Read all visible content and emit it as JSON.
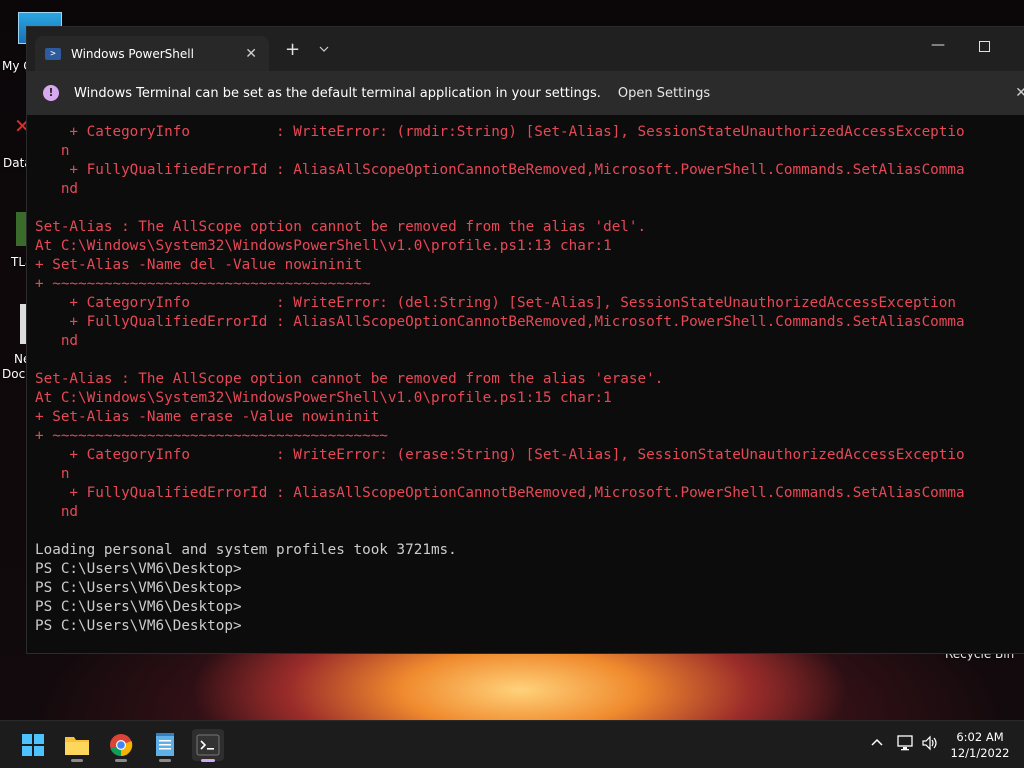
{
  "desktop": {
    "icons": [
      {
        "label": "My C",
        "top": 0
      },
      {
        "label": "Data",
        "top": 0
      },
      {
        "label": "TLa",
        "top": 0
      },
      {
        "label": "Ne",
        "top": 0
      },
      {
        "label": "Docu",
        "top": 0
      }
    ],
    "recycle_bin_label": "Recycle Bin"
  },
  "terminal": {
    "tab_title": "Windows PowerShell",
    "tab_close": "✕",
    "new_tab": "+",
    "dropdown": "⌄",
    "infobar": {
      "message": "Windows Terminal can be set as the default terminal application in your settings.",
      "link": "Open Settings"
    },
    "lines": [
      {
        "text": "    + CategoryInfo          : WriteError: (rmdir:String) [Set-Alias], SessionStateUnauthorizedAccessExceptio",
        "color": "red"
      },
      {
        "text": "   n",
        "color": "red"
      },
      {
        "text": "    + FullyQualifiedErrorId : AliasAllScopeOptionCannotBeRemoved,Microsoft.PowerShell.Commands.SetAliasComma",
        "color": "red"
      },
      {
        "text": "   nd",
        "color": "red"
      },
      {
        "text": "",
        "color": "default"
      },
      {
        "text": "Set-Alias : The AllScope option cannot be removed from the alias 'del'.",
        "color": "red"
      },
      {
        "text": "At C:\\Windows\\System32\\WindowsPowerShell\\v1.0\\profile.ps1:13 char:1",
        "color": "red"
      },
      {
        "text": "+ Set-Alias -Name del -Value nowininit",
        "color": "red"
      },
      {
        "text": "+ ~~~~~~~~~~~~~~~~~~~~~~~~~~~~~~~~~~~~~",
        "color": "red"
      },
      {
        "text": "    + CategoryInfo          : WriteError: (del:String) [Set-Alias], SessionStateUnauthorizedAccessException",
        "color": "red"
      },
      {
        "text": "    + FullyQualifiedErrorId : AliasAllScopeOptionCannotBeRemoved,Microsoft.PowerShell.Commands.SetAliasComma",
        "color": "red"
      },
      {
        "text": "   nd",
        "color": "red"
      },
      {
        "text": "",
        "color": "default"
      },
      {
        "text": "Set-Alias : The AllScope option cannot be removed from the alias 'erase'.",
        "color": "red"
      },
      {
        "text": "At C:\\Windows\\System32\\WindowsPowerShell\\v1.0\\profile.ps1:15 char:1",
        "color": "red"
      },
      {
        "text": "+ Set-Alias -Name erase -Value nowininit",
        "color": "red"
      },
      {
        "text": "+ ~~~~~~~~~~~~~~~~~~~~~~~~~~~~~~~~~~~~~~~",
        "color": "red"
      },
      {
        "text": "    + CategoryInfo          : WriteError: (erase:String) [Set-Alias], SessionStateUnauthorizedAccessExceptio",
        "color": "red"
      },
      {
        "text": "   n",
        "color": "red"
      },
      {
        "text": "    + FullyQualifiedErrorId : AliasAllScopeOptionCannotBeRemoved,Microsoft.PowerShell.Commands.SetAliasComma",
        "color": "red"
      },
      {
        "text": "   nd",
        "color": "red"
      },
      {
        "text": "",
        "color": "default"
      },
      {
        "text": "Loading personal and system profiles took 3721ms.",
        "color": "default"
      },
      {
        "text": "PS C:\\Users\\VM6\\Desktop>",
        "color": "default"
      },
      {
        "text": "PS C:\\Users\\VM6\\Desktop>",
        "color": "default"
      },
      {
        "text": "PS C:\\Users\\VM6\\Desktop>",
        "color": "default"
      },
      {
        "text": "PS C:\\Users\\VM6\\Desktop>",
        "color": "default"
      }
    ]
  },
  "taskbar": {
    "apps": [
      "start-icon",
      "file-explorer-icon",
      "chrome-icon",
      "notepad-icon",
      "terminal-icon"
    ],
    "clock_time": "6:02 AM",
    "clock_date": "12/1/2022"
  },
  "colors": {
    "error_red": "#e74856",
    "console_text": "#cccccc",
    "console_bg": "#0c0c0c",
    "accent": "#d2a6f0"
  }
}
